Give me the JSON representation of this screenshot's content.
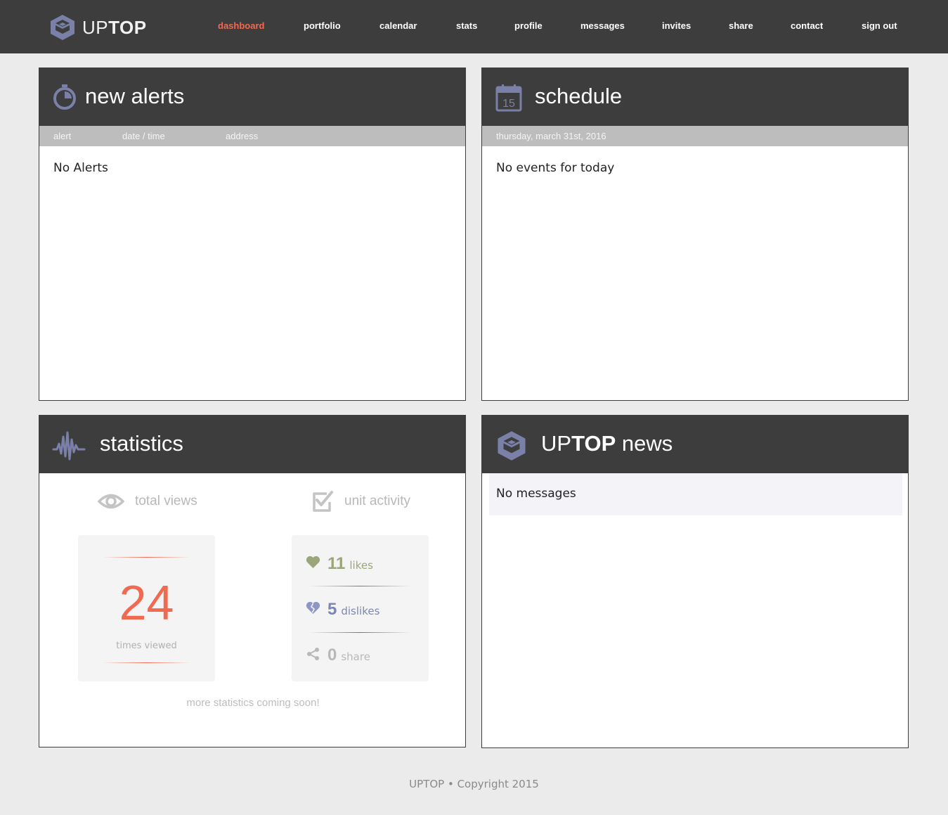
{
  "brand": {
    "name_light": "UP",
    "name_bold": "TOP"
  },
  "nav": {
    "items": [
      {
        "label": "dashboard",
        "active": true
      },
      {
        "label": "portfolio"
      },
      {
        "label": "calendar"
      },
      {
        "label": "stats"
      },
      {
        "label": "profile"
      },
      {
        "label": "messages"
      },
      {
        "label": "invites"
      },
      {
        "label": "share"
      },
      {
        "label": "contact"
      },
      {
        "label": "sign out"
      }
    ]
  },
  "alerts": {
    "title": "new alerts",
    "columns": [
      "alert",
      "date / time",
      "address"
    ],
    "empty": "No Alerts"
  },
  "schedule": {
    "title": "schedule",
    "calendar_icon_day": "15",
    "date": "thursday, march 31st, 2016",
    "empty": "No events for today"
  },
  "statistics": {
    "title": "statistics",
    "total_views_label": "total views",
    "unit_activity_label": "unit activity",
    "times_viewed_value": "24",
    "times_viewed_label": "times viewed",
    "likes_value": "11",
    "likes_label": "likes",
    "dislikes_value": "5",
    "dislikes_label": "dislikes",
    "share_value": "0",
    "share_label": "share",
    "coming_soon": "more statistics coming soon!"
  },
  "news": {
    "title_light": "UP",
    "title_bold": "TOP",
    "title_rest": " news",
    "empty": "No messages"
  },
  "footer": {
    "text": "UPTOP • Copyright 2015"
  },
  "colors": {
    "accent": "#ef6a50",
    "dark": "#3d3d3d",
    "icon": "#7a80a8",
    "likes": "#9aa67a",
    "dislikes": "#7d86b3",
    "muted": "#bdbdbd"
  }
}
